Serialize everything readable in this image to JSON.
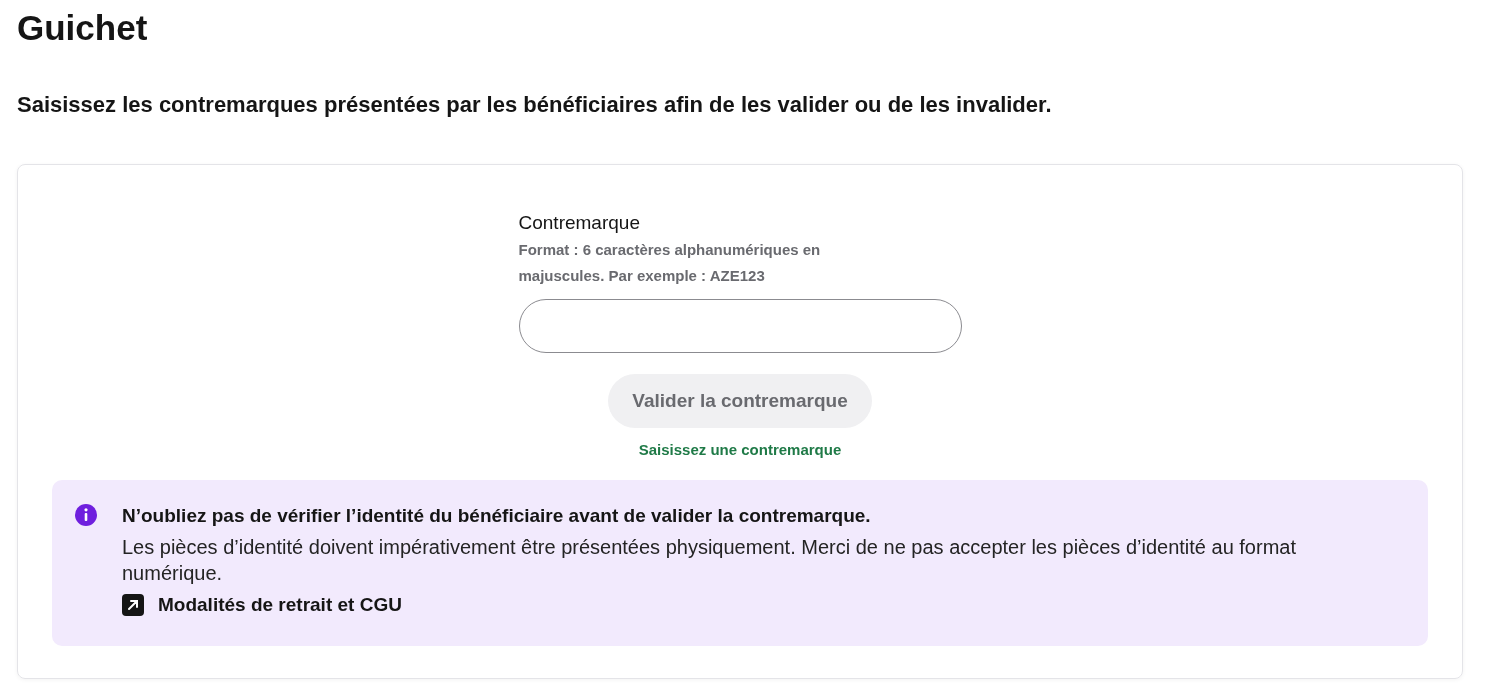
{
  "title": "Guichet",
  "intro": "Saisissez les contremarques présentées par les bénéficiaires afin de les valider ou de les invalider.",
  "form": {
    "label": "Contremarque",
    "hint": "Format : 6 caractères alphanumériques en majuscules. Par exemple : AZE123",
    "button": {
      "label": "Valider la contremarque",
      "disabled": true
    },
    "status": "Saisissez une contremarque"
  },
  "callout": {
    "title": "N’oubliez pas de vérifier l’identité du bénéficiaire avant de valider la contremarque.",
    "body": "Les pièces d’identité doivent impérativement être présentées physiquement. Merci de ne pas accepter les pièces d’identité au format numérique.",
    "link": "Modalités de retrait et CGU"
  }
}
